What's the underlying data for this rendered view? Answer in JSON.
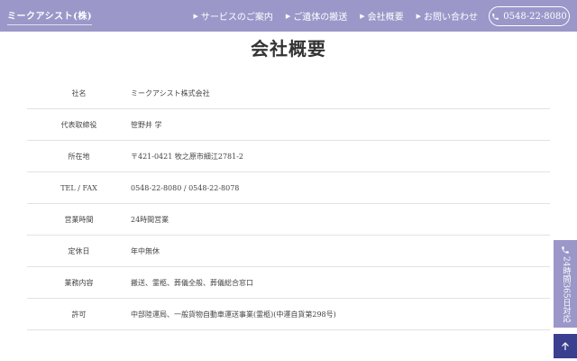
{
  "header": {
    "logo": "ミークアシスト(株)",
    "nav": [
      {
        "label": "サービスのご案内"
      },
      {
        "label": "ご遺体の搬送"
      },
      {
        "label": "会社概要"
      },
      {
        "label": "お問い合わせ"
      }
    ],
    "phone": "0548-22-8080"
  },
  "page": {
    "title": "会社概要"
  },
  "company_table": [
    {
      "label": "社名",
      "value": "ミークアシスト株式会社"
    },
    {
      "label": "代表取締役",
      "value": "笹野井 学"
    },
    {
      "label": "所在地",
      "value": "〒421-0421 牧之原市細江2781-2"
    },
    {
      "label": "TEL / FAX",
      "value": "0548-22-8080 / 0548-22-8078"
    },
    {
      "label": "営業時間",
      "value": "24時間営業"
    },
    {
      "label": "定休日",
      "value": "年中無休"
    },
    {
      "label": "業務内容",
      "value": "搬送、霊柩、葬儀全般、葬儀総合窓口"
    },
    {
      "label": "許可",
      "value": "中部陸運局、一般貨物自動車運送事業(霊柩)(中運自貨第298号)"
    }
  ],
  "side_tab": {
    "text": "24時間365日対応",
    "icon": "phone-icon"
  },
  "to_top": {
    "icon": "arrow-up-icon"
  },
  "colors": {
    "header": "#9b97c9",
    "to_top": "#3a3f8f"
  }
}
